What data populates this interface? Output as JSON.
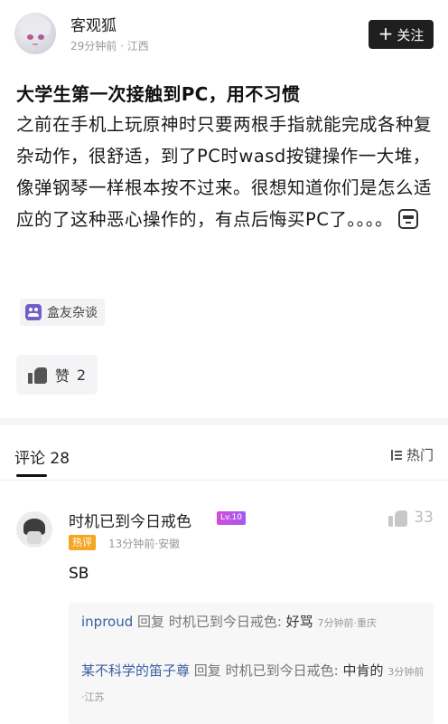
{
  "post": {
    "author": {
      "name": "客观狐",
      "time": "29分钟前",
      "location": "江西"
    },
    "follow_label": "关注",
    "title": "大学生第一次接触到PC，用不习惯",
    "body": "之前在手机上玩原神时只要两根手指就能完成各种复杂动作，很舒适，到了PC时wasd按键操作一大堆，像弹钢琴一样根本按不过来。很想知道你们是怎么适应的了这种恶心操作的，有点后悔买PC了。。。。",
    "topic": "盒友杂谈",
    "like_label": "赞",
    "like_count": "2"
  },
  "comments_section": {
    "tab_label": "评论",
    "count": "28",
    "sort_label": "热门"
  },
  "comments": [
    {
      "name": "时机已到今日戒色",
      "level": "Lv.10",
      "badge": "热评",
      "time": "13分钟前",
      "location": "安徽",
      "text": "SB",
      "likes": "33",
      "replies": [
        {
          "user": "inproud",
          "verb": "回复",
          "target": "时机已到今日戒色:",
          "text": "好骂",
          "time": "7分钟前",
          "location": "重庆"
        },
        {
          "user": "某不科学的笛子尊",
          "verb": "回复",
          "target": "时机已到今日戒色:",
          "text": "中肯的",
          "time": "3分钟前",
          "location": "江苏"
        }
      ]
    }
  ],
  "colors": {
    "follow_bg": "#1f1f1f",
    "reply_user": "#3b5fa0",
    "hot_badge": "#f5a623",
    "topic_icon": "#6f5fc9",
    "level_badge": "#c24ee0"
  }
}
